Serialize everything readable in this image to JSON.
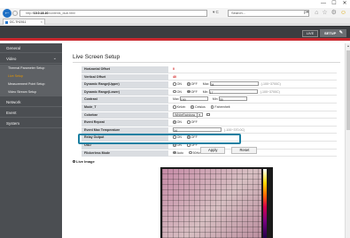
{
  "window": {
    "minimize": "—",
    "maximize": "☐",
    "close": "✕"
  },
  "browser": {
    "url_prefix": "http://",
    "url_host": "10.0.18.10",
    "url_rest": "/contents_dual.html",
    "addr_tools": "▾ C",
    "search_placeholder": "Search...",
    "search_tail": "ρ▾",
    "tab_title": "DC-TH2011",
    "tab_close": "×",
    "toolbar_icons": "⌂ ☆ ⚙"
  },
  "header": {
    "live_label": "LIVE",
    "setup_label": "SETUP"
  },
  "sidebar": {
    "menus": [
      {
        "label": "General"
      },
      {
        "label": "Video"
      },
      {
        "label": "Network"
      },
      {
        "label": "Event"
      },
      {
        "label": "System"
      }
    ],
    "submenus": [
      {
        "label": "Thermal Parameter Setup"
      },
      {
        "label": "Live Setup"
      },
      {
        "label": "Measurement Point Setup"
      },
      {
        "label": "Video Stream Setup"
      }
    ]
  },
  "main": {
    "title": "Live Screen Setup",
    "rows": {
      "h_offset": {
        "label": "Horizontal Offset",
        "value": "0"
      },
      "v_offset": {
        "label": "Vertical Offset",
        "value": "40"
      },
      "dyn_upper": {
        "label": "Dynamic Range(Upper)",
        "on": "ON",
        "off": "OFF",
        "max_label": "Max",
        "max_value": "34",
        "hint": "(-100~3700C)"
      },
      "dyn_lower": {
        "label": "Dynamic Range(Lower)",
        "on": "ON",
        "off": "OFF",
        "min_label": "Min",
        "min_value": "17",
        "hint": "(-100~3700C)"
      },
      "contrast": {
        "label": "Contrast",
        "max_label": "Max",
        "max_value": "190",
        "min_label": "Min",
        "min_value": "35"
      },
      "mode_t": {
        "label": "Mode_T",
        "opt1": "Kelvin",
        "opt2": "Celsius",
        "opt3": "Fahrenheit"
      },
      "colorbar": {
        "label": "Colorbar",
        "value": "WhiteRainbow"
      },
      "event_repeat": {
        "label": "Event Repeat",
        "on": "ON",
        "off": "OFF"
      },
      "event_max": {
        "label": "Event Max Temperature",
        "value": "34",
        "hint": "(-100~370.0C)"
      },
      "relay": {
        "label": "Relay Output",
        "on": "ON",
        "off": "OFF"
      },
      "osd": {
        "label": "OSD",
        "on": "ON",
        "off": "OFF"
      },
      "flicker": {
        "label": "Flickerless Mode",
        "opt1": "Auto",
        "opt2": "50Hz",
        "opt3": "60Hz"
      }
    },
    "apply_label": "Apply",
    "reset_label": "Reset",
    "live_image_label": "Live Image"
  },
  "colors": {
    "accent_red": "#c9282f",
    "highlight": "#1a7fa1",
    "sidebar": "#4b4e52",
    "active_sub": "#e59500"
  }
}
